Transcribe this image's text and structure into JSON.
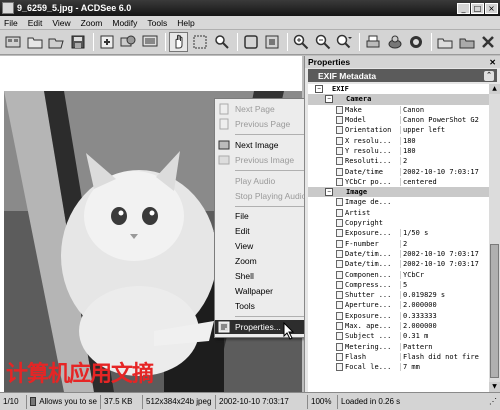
{
  "window": {
    "title": "9_6259_5.jpg - ACDSee 6.0",
    "minimize": "_",
    "maximize": "□",
    "close": "×"
  },
  "menu": [
    "File",
    "Edit",
    "View",
    "Zoom",
    "Modify",
    "Tools",
    "Help"
  ],
  "toolbar": [
    "browse",
    "open",
    "open-file",
    "save",
    "import",
    "acquire",
    "slideshow",
    "hand-tool",
    "select-tool",
    "zoom-tool",
    "fit",
    "actual-size",
    "zoom-in",
    "zoom-out",
    "zoom-dropdown",
    "print",
    "send",
    "rotate",
    "wallpaper",
    "edit",
    "delete"
  ],
  "context_menu": {
    "items": [
      {
        "label": "Next Page",
        "disabled": true,
        "submenu": false
      },
      {
        "label": "Previous Page",
        "disabled": true,
        "submenu": false
      },
      {
        "label": "Next Image",
        "disabled": false,
        "submenu": false
      },
      {
        "label": "Previous Image",
        "disabled": true,
        "submenu": false
      },
      {
        "label": "Play Audio",
        "disabled": true,
        "submenu": true
      },
      {
        "label": "Stop Playing Audio",
        "disabled": true,
        "submenu": false
      },
      {
        "label": "File",
        "disabled": false,
        "submenu": true
      },
      {
        "label": "Edit",
        "disabled": false,
        "submenu": true
      },
      {
        "label": "View",
        "disabled": false,
        "submenu": true
      },
      {
        "label": "Zoom",
        "disabled": false,
        "submenu": true
      },
      {
        "label": "Shell",
        "disabled": false,
        "submenu": true
      },
      {
        "label": "Wallpaper",
        "disabled": false,
        "submenu": true
      },
      {
        "label": "Tools",
        "disabled": false,
        "submenu": true
      },
      {
        "label": "Properties...",
        "disabled": false,
        "submenu": false,
        "highlighted": true
      }
    ]
  },
  "properties": {
    "panel_title": "Properties",
    "section_title": "EXIF Metadata",
    "root": "EXIF",
    "groups": [
      {
        "name": "Camera",
        "rows": [
          {
            "key": "Make",
            "value": "Canon"
          },
          {
            "key": "Model",
            "value": "Canon PowerShot G2"
          },
          {
            "key": "Orientation",
            "value": "upper left"
          },
          {
            "key": "X resolu...",
            "value": "180"
          },
          {
            "key": "Y resolu...",
            "value": "180"
          },
          {
            "key": "Resoluti...",
            "value": "2"
          },
          {
            "key": "Date/time",
            "value": "2002-10-10 7:03:17"
          },
          {
            "key": "YCbCr po...",
            "value": "centered"
          }
        ]
      },
      {
        "name": "Image",
        "rows": [
          {
            "key": "Image de...",
            "value": ""
          },
          {
            "key": "Artist",
            "value": ""
          },
          {
            "key": "Copyright",
            "value": ""
          },
          {
            "key": "Exposure...",
            "value": "1/50 s"
          },
          {
            "key": "F-number",
            "value": "2"
          },
          {
            "key": "Date/tim...",
            "value": "2002-10-10 7:03:17"
          },
          {
            "key": "Date/tim...",
            "value": "2002-10-10 7:03:17"
          },
          {
            "key": "Componen...",
            "value": "YCbCr"
          },
          {
            "key": "Compress...",
            "value": "5"
          },
          {
            "key": "Shutter ...",
            "value": "0.019829 s"
          },
          {
            "key": "Aperture...",
            "value": "2.000000"
          },
          {
            "key": "Exposure...",
            "value": "0.333333"
          },
          {
            "key": "Max. ape...",
            "value": "2.000000"
          },
          {
            "key": "Subject ...",
            "value": "0.31 m"
          },
          {
            "key": "Metering...",
            "value": "Pattern"
          },
          {
            "key": "Flash",
            "value": "Flash did not fire"
          },
          {
            "key": "Focal le...",
            "value": "7 mm"
          }
        ]
      }
    ]
  },
  "watermark": "计算机应用文摘",
  "status": {
    "position": "1/10",
    "description": "Allows you to se",
    "filesize": "37.5 KB",
    "dimensions": "512x384x24b jpeg",
    "date": "2002-10-10 7:03:17",
    "zoom": "100%",
    "load_time": "Loaded in 0.26 s"
  }
}
